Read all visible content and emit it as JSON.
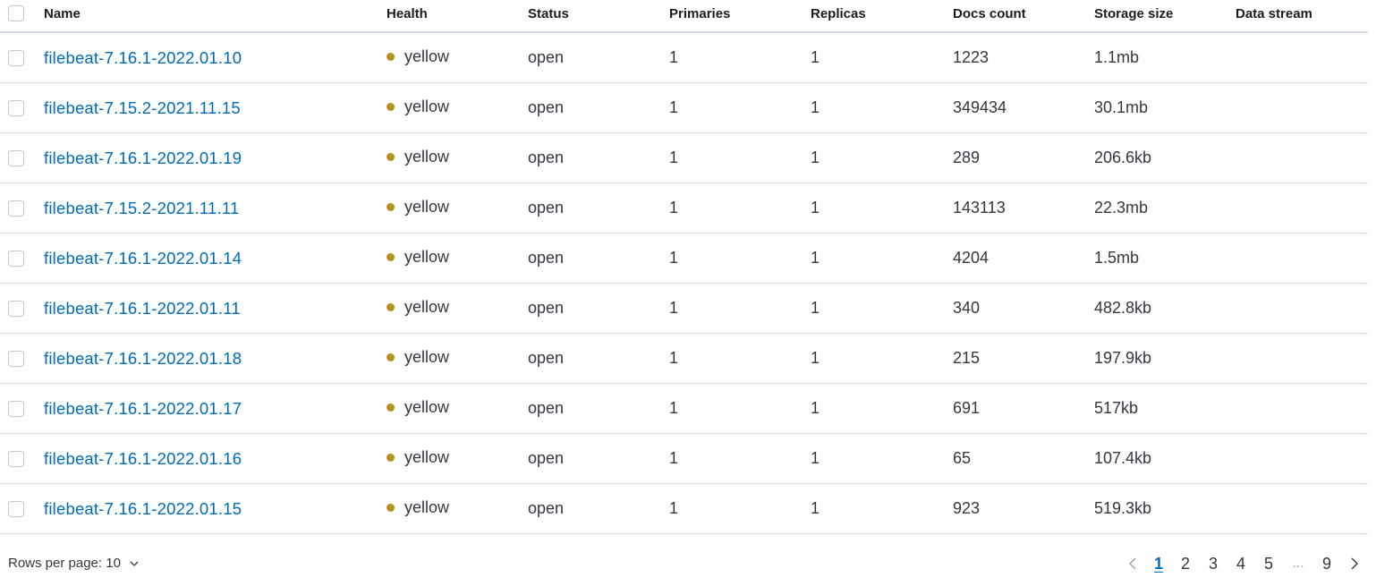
{
  "table": {
    "columns": {
      "name": "Name",
      "health": "Health",
      "status": "Status",
      "primaries": "Primaries",
      "replicas": "Replicas",
      "docs_count": "Docs count",
      "storage_size": "Storage size",
      "data_stream": "Data stream"
    },
    "rows": [
      {
        "name": "filebeat-7.16.1-2022.01.10",
        "health": "yellow",
        "status": "open",
        "primaries": "1",
        "replicas": "1",
        "docs_count": "1223",
        "storage_size": "1.1mb",
        "data_stream": ""
      },
      {
        "name": "filebeat-7.15.2-2021.11.15",
        "health": "yellow",
        "status": "open",
        "primaries": "1",
        "replicas": "1",
        "docs_count": "349434",
        "storage_size": "30.1mb",
        "data_stream": ""
      },
      {
        "name": "filebeat-7.16.1-2022.01.19",
        "health": "yellow",
        "status": "open",
        "primaries": "1",
        "replicas": "1",
        "docs_count": "289",
        "storage_size": "206.6kb",
        "data_stream": ""
      },
      {
        "name": "filebeat-7.15.2-2021.11.11",
        "health": "yellow",
        "status": "open",
        "primaries": "1",
        "replicas": "1",
        "docs_count": "143113",
        "storage_size": "22.3mb",
        "data_stream": ""
      },
      {
        "name": "filebeat-7.16.1-2022.01.14",
        "health": "yellow",
        "status": "open",
        "primaries": "1",
        "replicas": "1",
        "docs_count": "4204",
        "storage_size": "1.5mb",
        "data_stream": ""
      },
      {
        "name": "filebeat-7.16.1-2022.01.11",
        "health": "yellow",
        "status": "open",
        "primaries": "1",
        "replicas": "1",
        "docs_count": "340",
        "storage_size": "482.8kb",
        "data_stream": ""
      },
      {
        "name": "filebeat-7.16.1-2022.01.18",
        "health": "yellow",
        "status": "open",
        "primaries": "1",
        "replicas": "1",
        "docs_count": "215",
        "storage_size": "197.9kb",
        "data_stream": ""
      },
      {
        "name": "filebeat-7.16.1-2022.01.17",
        "health": "yellow",
        "status": "open",
        "primaries": "1",
        "replicas": "1",
        "docs_count": "691",
        "storage_size": "517kb",
        "data_stream": ""
      },
      {
        "name": "filebeat-7.16.1-2022.01.16",
        "health": "yellow",
        "status": "open",
        "primaries": "1",
        "replicas": "1",
        "docs_count": "65",
        "storage_size": "107.4kb",
        "data_stream": ""
      },
      {
        "name": "filebeat-7.16.1-2022.01.15",
        "health": "yellow",
        "status": "open",
        "primaries": "1",
        "replicas": "1",
        "docs_count": "923",
        "storage_size": "519.3kb",
        "data_stream": ""
      }
    ]
  },
  "colors": {
    "link": "#006bb8",
    "health_yellow": "#b9901b",
    "border": "#d3dae6",
    "text": "#343741"
  },
  "footer": {
    "rows_per_page_label": "Rows per page: 10",
    "rows_per_page_icon": "chevron-down-icon",
    "pagination": {
      "prev_icon": "chevron-left-icon",
      "next_icon": "chevron-right-icon",
      "pages": [
        "1",
        "2",
        "3",
        "4",
        "5"
      ],
      "ellipsis": "...",
      "last_page": "9",
      "current_page": "1"
    }
  }
}
